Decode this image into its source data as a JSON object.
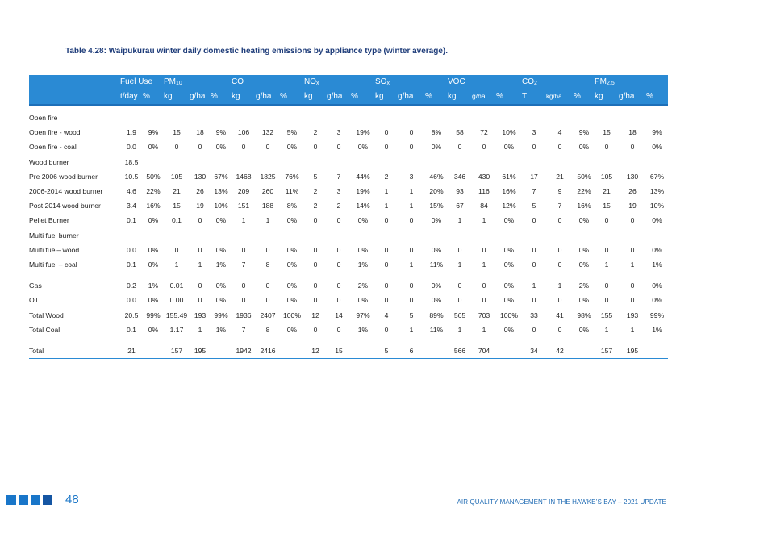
{
  "title": "Table 4.28: Waipukurau winter daily domestic heating emissions by appliance type (winter average).",
  "header1": {
    "fuel": "Fuel Use",
    "pm10_main": "PM",
    "pm10_sub": "10",
    "co": "CO",
    "nox_main": "NO",
    "nox_sub": "x",
    "sox_main": "SO",
    "sox_sub": "x",
    "voc": "VOC",
    "co2_main": "CO",
    "co2_sub": "2",
    "pm25_main": "PM",
    "pm25_sub": "2.5"
  },
  "header2": [
    "t/day",
    "%",
    "kg",
    "g/ha",
    "%",
    "kg",
    "g/ha",
    "%",
    "kg",
    "g/ha",
    "%",
    "kg",
    "g/ha",
    "%",
    "kg",
    "g/ha",
    "%",
    "T",
    "kg/ha",
    "%",
    "kg",
    "g/ha",
    "%"
  ],
  "rows": [
    {
      "label": "Open fire",
      "cells": [
        "",
        "",
        "",
        "",
        "",
        "",
        "",
        "",
        "",
        "",
        "",
        "",
        "",
        "",
        "",
        "",
        "",
        "",
        "",
        "",
        "",
        "",
        ""
      ]
    },
    {
      "label": "Open fire - wood",
      "cells": [
        "1.9",
        "9%",
        "15",
        "18",
        "9%",
        "106",
        "132",
        "5%",
        "2",
        "3",
        "19%",
        "0",
        "0",
        "8%",
        "58",
        "72",
        "10%",
        "3",
        "4",
        "9%",
        "15",
        "18",
        "9%"
      ]
    },
    {
      "label": "Open fire - coal",
      "cells": [
        "0.0",
        "0%",
        "0",
        "0",
        "0%",
        "0",
        "0",
        "0%",
        "0",
        "0",
        "0%",
        "0",
        "0",
        "0%",
        "0",
        "0",
        "0%",
        "0",
        "0",
        "0%",
        "0",
        "0",
        "0%"
      ]
    },
    {
      "label": "Wood burner",
      "cells": [
        "18.5",
        "",
        "",
        "",
        "",
        "",
        "",
        "",
        "",
        "",
        "",
        "",
        "",
        "",
        "",
        "",
        "",
        "",
        "",
        "",
        "",
        "",
        ""
      ]
    },
    {
      "label": "Pre 2006 wood burner",
      "cells": [
        "10.5",
        "50%",
        "105",
        "130",
        "67%",
        "1468",
        "1825",
        "76%",
        "5",
        "7",
        "44%",
        "2",
        "3",
        "46%",
        "346",
        "430",
        "61%",
        "17",
        "21",
        "50%",
        "105",
        "130",
        "67%"
      ]
    },
    {
      "label": "2006-2014 wood burner",
      "cells": [
        "4.6",
        "22%",
        "21",
        "26",
        "13%",
        "209",
        "260",
        "11%",
        "2",
        "3",
        "19%",
        "1",
        "1",
        "20%",
        "93",
        "116",
        "16%",
        "7",
        "9",
        "22%",
        "21",
        "26",
        "13%"
      ]
    },
    {
      "label": "Post 2014 wood burner",
      "cells": [
        "3.4",
        "16%",
        "15",
        "19",
        "10%",
        "151",
        "188",
        "8%",
        "2",
        "2",
        "14%",
        "1",
        "1",
        "15%",
        "67",
        "84",
        "12%",
        "5",
        "7",
        "16%",
        "15",
        "19",
        "10%"
      ]
    },
    {
      "label": "Pellet Burner",
      "cells": [
        "0.1",
        "0%",
        "0.1",
        "0",
        "0%",
        "1",
        "1",
        "0%",
        "0",
        "0",
        "0%",
        "0",
        "0",
        "0%",
        "1",
        "1",
        "0%",
        "0",
        "0",
        "0%",
        "0",
        "0",
        "0%"
      ]
    },
    {
      "label": "Multi fuel burner",
      "cells": [
        "",
        "",
        "",
        "",
        "",
        "",
        "",
        "",
        "",
        "",
        "",
        "",
        "",
        "",
        "",
        "",
        "",
        "",
        "",
        "",
        "",
        "",
        ""
      ]
    },
    {
      "label": "Multi fuel– wood",
      "cells": [
        "0.0",
        "0%",
        "0",
        "0",
        "0%",
        "0",
        "0",
        "0%",
        "0",
        "0",
        "0%",
        "0",
        "0",
        "0%",
        "0",
        "0",
        "0%",
        "0",
        "0",
        "0%",
        "0",
        "0",
        "0%"
      ]
    },
    {
      "label": "Multi fuel – coal",
      "cells": [
        "0.1",
        "0%",
        "1",
        "1",
        "1%",
        "7",
        "8",
        "0%",
        "0",
        "0",
        "1%",
        "0",
        "1",
        "11%",
        "1",
        "1",
        "0%",
        "0",
        "0",
        "0%",
        "1",
        "1",
        "1%"
      ]
    },
    {
      "label": "",
      "cells": [
        "",
        "",
        "",
        "",
        "",
        "",
        "",
        "",
        "",
        "",
        "",
        "",
        "",
        "",
        "",
        "",
        "",
        "",
        "",
        "",
        "",
        "",
        ""
      ]
    },
    {
      "label": "Gas",
      "cells": [
        "0.2",
        "1%",
        "0.01",
        "0",
        "0%",
        "0",
        "0",
        "0%",
        "0",
        "0",
        "2%",
        "0",
        "0",
        "0%",
        "0",
        "0",
        "0%",
        "1",
        "1",
        "2%",
        "0",
        "0",
        "0%"
      ]
    },
    {
      "label": "Oil",
      "cells": [
        "0.0",
        "0%",
        "0.00",
        "0",
        "0%",
        "0",
        "0",
        "0%",
        "0",
        "0",
        "0%",
        "0",
        "0",
        "0%",
        "0",
        "0",
        "0%",
        "0",
        "0",
        "0%",
        "0",
        "0",
        "0%"
      ]
    },
    {
      "label": "Total Wood",
      "cells": [
        "20.5",
        "99%",
        "155.49",
        "193",
        "99%",
        "1936",
        "2407",
        "100%",
        "12",
        "14",
        "97%",
        "4",
        "5",
        "89%",
        "565",
        "703",
        "100%",
        "33",
        "41",
        "98%",
        "155",
        "193",
        "99%"
      ]
    },
    {
      "label": "Total Coal",
      "cells": [
        "0.1",
        "0%",
        "1.17",
        "1",
        "1%",
        "7",
        "8",
        "0%",
        "0",
        "0",
        "1%",
        "0",
        "1",
        "11%",
        "1",
        "1",
        "0%",
        "0",
        "0",
        "0%",
        "1",
        "1",
        "1%"
      ]
    },
    {
      "label": "",
      "cells": [
        "",
        "",
        "",
        "",
        "",
        "",
        "",
        "",
        "",
        "",
        "",
        "",
        "",
        "",
        "",
        "",
        "",
        "",
        "",
        "",
        "",
        "",
        ""
      ]
    },
    {
      "label": "Total",
      "cells": [
        "21",
        "",
        "157",
        "195",
        "",
        "1942",
        "2416",
        "",
        "12",
        "15",
        "",
        "5",
        "6",
        "",
        "566",
        "704",
        "",
        "34",
        "42",
        "",
        "157",
        "195",
        ""
      ]
    }
  ],
  "footer": {
    "page_number": "48",
    "text": "AIR QUALITY MANAGEMENT IN THE HAWKE’S BAY – 2021 UPDATE"
  },
  "colors": {
    "header_bg": "#2a8ad4",
    "title": "#1f3d7a",
    "footer_blue": "#1e6ab3"
  }
}
